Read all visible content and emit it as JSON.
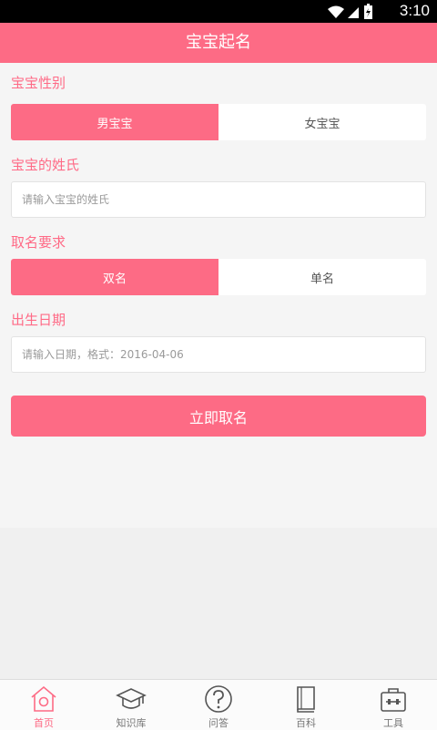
{
  "status_bar": {
    "time": "3:10"
  },
  "app_bar": {
    "title": "宝宝起名"
  },
  "form": {
    "gender": {
      "label": "宝宝性别",
      "options": [
        "男宝宝",
        "女宝宝"
      ],
      "selected": "男宝宝"
    },
    "surname": {
      "label": "宝宝的姓氏",
      "placeholder": "请输入宝宝的姓氏",
      "value": ""
    },
    "name_type": {
      "label": "取名要求",
      "options": [
        "双名",
        "单名"
      ],
      "selected": "双名"
    },
    "birth_date": {
      "label": "出生日期",
      "placeholder": "请输入日期，格式：2016-04-06",
      "value": ""
    },
    "submit_label": "立即取名"
  },
  "tab_bar": {
    "items": [
      {
        "label": "首页",
        "icon": "home-icon",
        "active": true
      },
      {
        "label": "知识库",
        "icon": "graduation-cap-icon",
        "active": false
      },
      {
        "label": "问答",
        "icon": "question-icon",
        "active": false
      },
      {
        "label": "百科",
        "icon": "book-icon",
        "active": false
      },
      {
        "label": "工具",
        "icon": "toolbox-icon",
        "active": false
      }
    ]
  },
  "colors": {
    "accent": "#fd6b85",
    "background": "#f5f5f5"
  }
}
